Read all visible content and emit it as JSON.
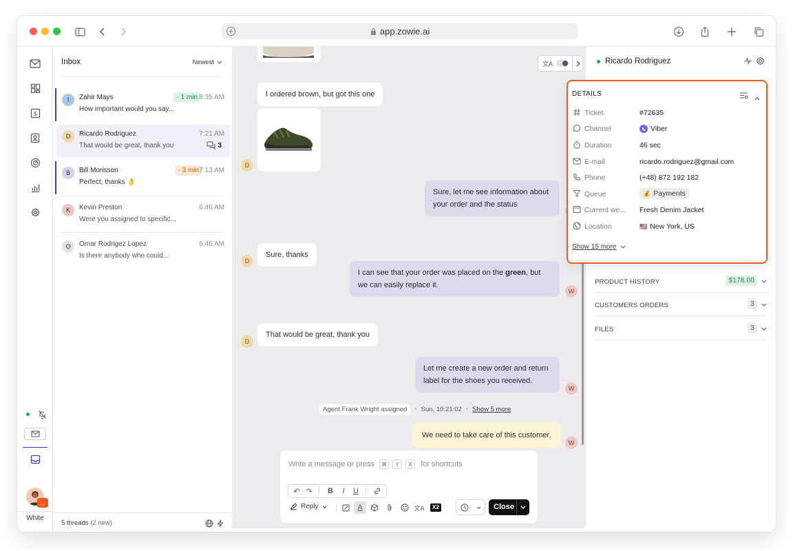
{
  "browser": {
    "url": "app.zowie.ai"
  },
  "inbox": {
    "title": "Inbox",
    "sort": "Newest",
    "footer": {
      "threads": "5 threads",
      "new": "(2 new)"
    },
    "threads": [
      {
        "initial": "I",
        "name": "Zahir Mays",
        "preview": "How important would you say...",
        "badge": "- 1 min",
        "time": "8:35 AM",
        "avatar_color": "#a9c7e6"
      },
      {
        "initial": "D",
        "name": "Ricardo Rodriguez",
        "preview": "That would be great, thank you",
        "time": "7:21 AM",
        "count": "3",
        "avatar_color": "#f0d8a8"
      },
      {
        "initial": "B",
        "name": "Bill Morisson",
        "preview": "Perfect, thanks 👌",
        "badge": "- 3 min",
        "time": "7:13 AM",
        "avatar_color": "#d6d2ee"
      },
      {
        "initial": "K",
        "name": "Kevin Preston",
        "preview": "Were you assigned to specific...",
        "time": "6:46 AM",
        "avatar_color": "#efc7c2"
      },
      {
        "initial": "O",
        "name": "Omar Rodrigez Lopez",
        "preview": "Is there anybody who could...",
        "time": "6:46 AM",
        "avatar_color": "#e2e2e6"
      }
    ]
  },
  "rail": {
    "user_label": "White",
    "user_badge": "..."
  },
  "conversation": {
    "messages": [
      {
        "text": "I ordered brown, but got this one"
      },
      {
        "text": "Sure, let me see information about your order and the status"
      },
      {
        "text": "Sure, thanks"
      },
      {
        "text_pre": "I can see that your order was placed on the ",
        "text_bold": "green",
        "text_post": ", but we can easily replace it."
      },
      {
        "text": "That would be great, thank you"
      },
      {
        "text": "Let me create a new order and return label for the shoes you received."
      },
      {
        "text": "We need to take care of this customer."
      }
    ],
    "customer_initial": "D",
    "agent_initial": "W",
    "event": {
      "text": "Agent Frank Wright assigned",
      "time": "Sun, 10:21:02",
      "more": "Show 5 more"
    }
  },
  "composer": {
    "placeholder": "Write a message or press",
    "keys": [
      "⌘",
      "⇧",
      "X"
    ],
    "shortcuts": "for shortcuts",
    "reply": "Reply",
    "close": "Close",
    "x2": "X2"
  },
  "customer": {
    "name": "Ricardo Rodriguez",
    "status_color": "#22a55a"
  },
  "details": {
    "title": "DETAILS",
    "rows": [
      {
        "icon": "hash-icon",
        "key": "Ticket",
        "value": "#72635"
      },
      {
        "icon": "chat-icon",
        "key": "Channel",
        "value": "Viber"
      },
      {
        "icon": "timer-icon",
        "key": "Duration",
        "value": "46 sec"
      },
      {
        "icon": "mail-icon",
        "key": "E-mail",
        "value": "ricardo.rodriguez@gmail.com"
      },
      {
        "icon": "phone-icon",
        "key": "Phone",
        "value": "(+48) 872 192 182"
      },
      {
        "icon": "filter-icon",
        "key": "Queue",
        "value": "Payments",
        "emoji": "💰"
      },
      {
        "icon": "browser-icon",
        "key": "Current we...",
        "value": "Fresh Denim Jacket"
      },
      {
        "icon": "globe-icon",
        "key": "Location",
        "value": "New York, US",
        "emoji": "🇺🇸"
      }
    ],
    "show_more": "Show 15 more"
  },
  "sections": [
    {
      "title": "PRODUCT HISTORY",
      "badge": "$178.00"
    },
    {
      "title": "CUSTOMERS ORDERS",
      "badge": "3"
    },
    {
      "title": "FILES",
      "badge": "3"
    }
  ],
  "colors": {
    "accent": "#f05a1e",
    "inbox_mark": "#3b3bd0",
    "viber": "#7360f2"
  }
}
